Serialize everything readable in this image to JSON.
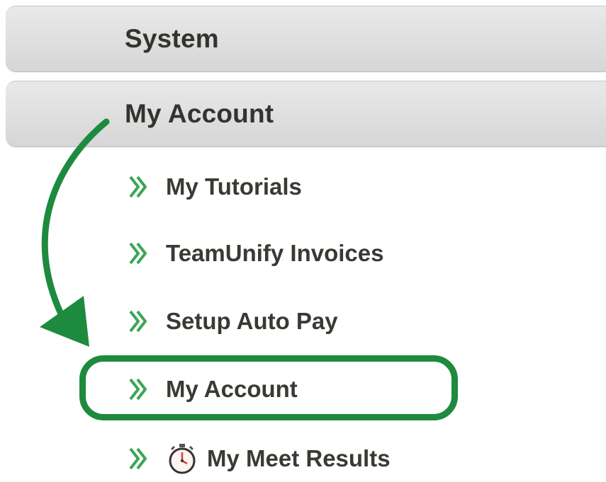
{
  "sections": {
    "system": {
      "label": "System"
    },
    "my_account": {
      "label": "My Account"
    }
  },
  "menu": {
    "items": [
      {
        "label": "My Tutorials",
        "icon": "chevron-double-right-icon"
      },
      {
        "label": "TeamUnify Invoices",
        "icon": "chevron-double-right-icon"
      },
      {
        "label": "Setup Auto Pay",
        "icon": "chevron-double-right-icon"
      },
      {
        "label": "My Account",
        "icon": "chevron-double-right-icon",
        "highlighted": true
      },
      {
        "label": "My Meet Results",
        "icon": "chevron-double-right-icon",
        "extra_icon": "stopwatch-icon"
      }
    ]
  },
  "annotation": {
    "arrow_color": "#1e8a3e",
    "highlight_color": "#1e8a3e"
  },
  "colors": {
    "chevron": "#3aa655",
    "header_bg": "#dedede",
    "text": "#33332f"
  }
}
